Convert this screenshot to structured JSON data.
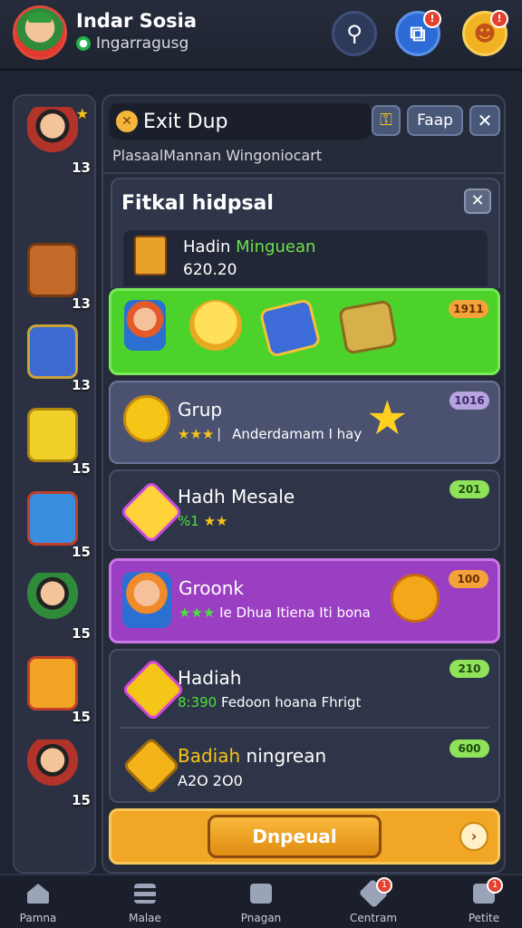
{
  "header": {
    "username": "Indar Sosia",
    "subtitle": "Ingarragusg",
    "subtitle_icon": "chat-icon",
    "buttons": [
      {
        "icon": "chat-bubble-icon",
        "glyph": "⚲"
      },
      {
        "icon": "copy-icon",
        "glyph": "⧉",
        "badge": "!"
      },
      {
        "icon": "smiley-icon",
        "glyph": "☻",
        "badge": "!"
      }
    ]
  },
  "sidebar": {
    "items": [
      {
        "icon": "character-avatar",
        "count": "13"
      },
      {
        "icon": "chest-icon",
        "count": "13"
      },
      {
        "icon": "blue-chest-icon",
        "count": "13"
      },
      {
        "icon": "gold-block-icon",
        "count": "15"
      },
      {
        "icon": "toolbox-icon",
        "count": "15"
      },
      {
        "icon": "character-avatar-2",
        "count": "15"
      },
      {
        "icon": "gold-crate-icon",
        "count": "15"
      },
      {
        "icon": "character-avatar-3",
        "count": "15"
      }
    ]
  },
  "panel": {
    "exit_label": "Exit Dup",
    "fap_label": "Faap",
    "caption": "PlasaalMannan Wingoniocart",
    "section_title": "Fitkal hidpsal",
    "section_row": {
      "name_white": "Hadin ",
      "name_green": "Minguean",
      "value": "620.20"
    }
  },
  "cards": [
    {
      "type": "green",
      "badge": "1911"
    },
    {
      "type": "blue",
      "title": "Grup",
      "subtitle": "⎸Anderdamam I hay",
      "badge": "1016"
    },
    {
      "type": "dark",
      "title": "Hadh Mesale",
      "stars_text": "%1",
      "badge": "201"
    },
    {
      "type": "purple",
      "title": "Groonk",
      "subtitle": "Ie Dhua Itiena Iti bona",
      "badge": "100"
    },
    {
      "type": "dark2",
      "title": "Hadiah",
      "sub_value": "8:390",
      "subtitle": "Fedoon hoana Fhrigt",
      "badge": "210"
    },
    {
      "type": "dark2b",
      "title_gold": "Badiah ",
      "title_white": "ningrean",
      "value": "A2O 2O0",
      "badge": "600"
    }
  ],
  "claim_button": "Dnpeual",
  "navbar": [
    {
      "label": "Pamna",
      "icon": "home-icon"
    },
    {
      "label": "Malae",
      "icon": "list-icon"
    },
    {
      "label": "Pnagan",
      "icon": "gift-icon"
    },
    {
      "label": "Centram",
      "icon": "tools-icon",
      "badge": "1"
    },
    {
      "label": "Petite",
      "icon": "store-icon",
      "badge": "1"
    }
  ]
}
